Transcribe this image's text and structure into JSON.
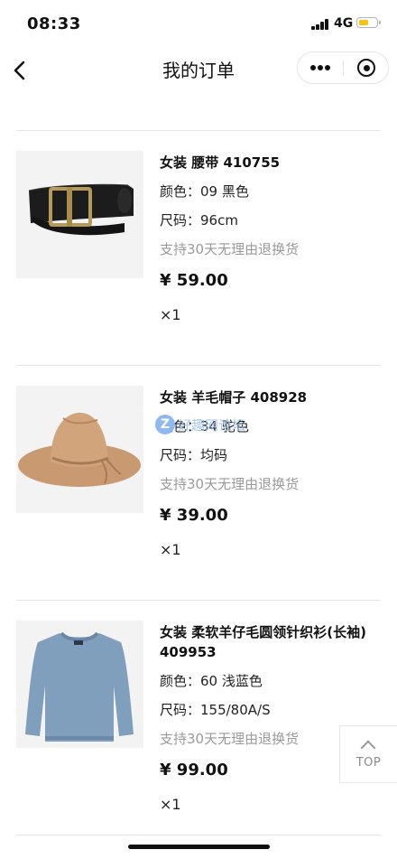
{
  "status_bar": {
    "time": "08:33",
    "network": "4G",
    "battery_level_fraction": 0.55,
    "battery_color": "#f2c417"
  },
  "nav": {
    "title": "我的订单",
    "back_icon": "chevron-left-icon",
    "more_icon": "more-dots-icon",
    "close_icon": "target-close-icon"
  },
  "orders": [
    {
      "name": "女装 腰带 410755",
      "color_line": "颜色：09 黑色",
      "size_line": "尺码：96cm",
      "policy": "支持30天无理由退换货",
      "price": "¥ 59.00",
      "quantity": "×1",
      "image": "black-leather-belt"
    },
    {
      "name": "女装 羊毛帽子 408928",
      "color_line": "颜色：34 驼色",
      "size_line": "尺码：均码",
      "policy": "支持30天无理由退换货",
      "price": "¥ 39.00",
      "quantity": "×1",
      "image": "camel-wool-hat"
    },
    {
      "name": "女装 柔软羊仔毛圆领针织衫(长袖) 409953",
      "color_line": "颜色：60 浅蓝色",
      "size_line": "尺码：155/80A/S",
      "policy": "支持30天无理由退换货",
      "price": "¥ 99.00",
      "quantity": "×1",
      "image": "light-blue-sweater"
    }
  ],
  "top_button": {
    "label": "TOP",
    "icon": "chevron-up-icon"
  },
  "watermark": {
    "badge": "Z",
    "text": "好趣网论坛"
  }
}
